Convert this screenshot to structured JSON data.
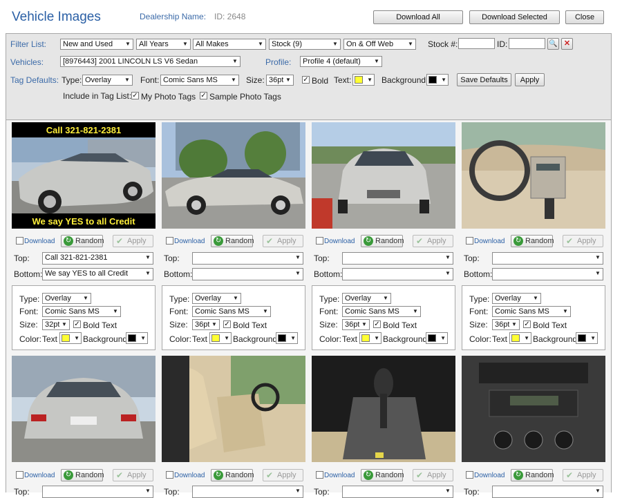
{
  "header": {
    "title": "Vehicle Images",
    "dealership_label": "Dealership Name:",
    "dealership_id": "ID: 2648",
    "buttons": {
      "download_all": "Download All",
      "download_selected": "Download Selected",
      "close": "Close"
    }
  },
  "filter": {
    "label": "Filter List:",
    "condition": "New and Used",
    "years": "All Years",
    "makes": "All Makes",
    "stock": "Stock (9)",
    "web": "On & Off Web",
    "stock_label": "Stock #:",
    "id_label": "ID:"
  },
  "vehicles": {
    "label": "Vehicles:",
    "value": "[8976443] 2001 LINCOLN LS V6 Sedan",
    "profile_label": "Profile:",
    "profile": "Profile 4 (default)"
  },
  "tag_defaults": {
    "label": "Tag Defaults:",
    "type_label": "Type:",
    "type": "Overlay",
    "font_label": "Font:",
    "font": "Comic Sans MS",
    "size_label": "Size:",
    "size": "36pt",
    "bold": "Bold",
    "text_label": "Text:",
    "text_color": "#ffff33",
    "bg_label": "Background:",
    "bg_color": "#000000",
    "save": "Save Defaults",
    "apply": "Apply"
  },
  "include": {
    "label": "Include in Tag List:",
    "my": "My Photo Tags",
    "sample": "Sample Photo Tags"
  },
  "card_labels": {
    "download": "Download",
    "random": "Random",
    "apply": "Apply",
    "top": "Top:",
    "bottom": "Bottom:",
    "type": "Type:",
    "font": "Font:",
    "size": "Size:",
    "bold": "Bold Text",
    "color": "Color:",
    "text": "Text",
    "background": "Background"
  },
  "cards": [
    {
      "photo": "sedan-front-three-quarter-tagged",
      "banner_top": "Call 321-821-2381",
      "banner_bottom": "We say YES to all Credit",
      "top": "Call 321-821-2381",
      "bottom": "We say YES to all Credit",
      "type": "Overlay",
      "font": "Comic Sans MS",
      "size": "32pt"
    },
    {
      "photo": "sedan-side-view",
      "top": "",
      "bottom": "",
      "type": "Overlay",
      "font": "Comic Sans MS",
      "size": "36pt"
    },
    {
      "photo": "sedan-front-view",
      "top": "",
      "bottom": "",
      "type": "Overlay",
      "font": "Comic Sans MS",
      "size": "36pt"
    },
    {
      "photo": "dashboard-interior",
      "top": "",
      "bottom": "",
      "type": "Overlay",
      "font": "Comic Sans MS",
      "size": "36pt"
    },
    {
      "photo": "sedan-rear-view",
      "top": "",
      "bottom": ""
    },
    {
      "photo": "front-seats-interior",
      "top": "",
      "bottom": ""
    },
    {
      "photo": "gear-shifter",
      "top": "",
      "bottom": ""
    },
    {
      "photo": "center-console-radio",
      "top": "",
      "bottom": ""
    }
  ],
  "colors": {
    "accent": "#2a5fa5",
    "text_swatch": "#ffff33",
    "bg_swatch": "#000000"
  }
}
